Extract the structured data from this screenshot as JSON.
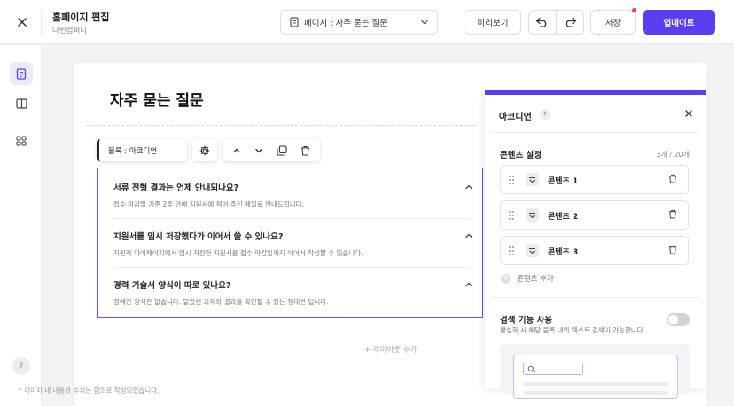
{
  "header": {
    "title": "홈페이지 편집",
    "subtitle": "나인컴퍼니",
    "page_select": "페이지 : 자주 묻는 질문",
    "preview_label": "미리보기",
    "save_label": "저장",
    "update_label": "업데이트"
  },
  "canvas": {
    "page_heading": "자주 묻는 질문",
    "add_layout": "+ 레이아웃 추가",
    "block_label": "블록 : 아코디언"
  },
  "faq": [
    {
      "q": "서류 전형 결과는 언제 안내되나요?",
      "a": "접수 마감일 기준 2주 안에 지원서에 적어 주신 메일로 안내드립니다."
    },
    {
      "q": "지원서를 임시 저장했다가 이어서 쓸 수 있나요?",
      "a": "지원자 마이페이지에서 임시 저장한 지원서를 접수 마감일까지 이어서 작성할 수 있습니다."
    },
    {
      "q": "경력 기술서 양식이 따로 있나요?",
      "a": "정해진 양식은 없습니다. 맡았던 과제와 결과를 확인할 수 있는 형태면 됩니다."
    }
  ],
  "panel": {
    "title": "아코디언",
    "help": "?",
    "content_settings": "콘텐츠 설정",
    "content_count": "3개 / 20개",
    "items": [
      "콘텐츠 1",
      "콘텐츠 2",
      "콘텐츠 3"
    ],
    "add_content": "콘텐츠 추가",
    "search_title": "검색 기능 사용",
    "search_desc": "활성화 시 해당 블록 내의 텍스트 검색이 가능합니다.",
    "search_enabled": false
  },
  "help_label": "?",
  "disclaimer": "* 이미지 내 내용과 수치는 임의로 작성되었습니다.",
  "icons": {
    "close": "close-icon",
    "page": "page-icon",
    "chevron": "chevron-down-icon",
    "undo": "undo-icon",
    "redo": "redo-icon",
    "pages_nav": "pages-icon",
    "layout_nav": "layout-icon",
    "grid_nav": "grid-icon",
    "gear": "gear-icon",
    "up": "arrow-up-icon",
    "down": "arrow-down-icon",
    "copy": "copy-icon",
    "trash": "trash-icon",
    "drag": "drag-handle-icon"
  },
  "colors": {
    "accent": "#5a3df0",
    "selection": "#6a4ff5",
    "badge": "#f04848"
  }
}
